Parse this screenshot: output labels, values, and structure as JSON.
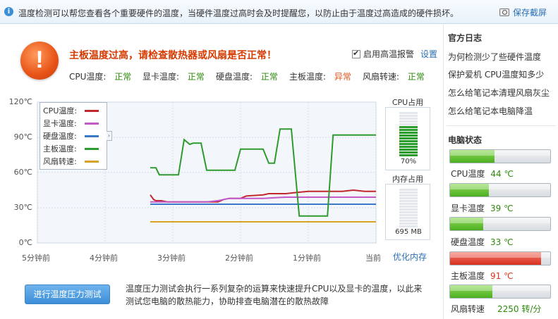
{
  "topbar": {
    "info": "温度检测可以帮您查看各个重要硬件的温度，当硬件温度过高时会及时提醒您，以防止由于温度过高造成的硬件损坏。",
    "save_screenshot": "保存截屏"
  },
  "alert": {
    "title": "主板温度过高，请检查散热器或风扇是否正常！",
    "alarm_label": "启用高温报警",
    "alarm_checked": true,
    "settings": "设置"
  },
  "status": [
    {
      "label": "CPU温度:",
      "value": "正常",
      "ok": true
    },
    {
      "label": "显卡温度:",
      "value": "正常",
      "ok": true
    },
    {
      "label": "硬盘温度:",
      "value": "正常",
      "ok": true
    },
    {
      "label": "主板温度:",
      "value": "异常",
      "ok": false
    },
    {
      "label": "风扇转速:",
      "value": "正常",
      "ok": true
    }
  ],
  "chart_data": {
    "type": "line",
    "ylim": [
      0,
      120
    ],
    "y_ticks": [
      "120℃",
      "90℃",
      "60℃",
      "30℃",
      "0℃"
    ],
    "x_ticks": [
      "5分钟前",
      "4分钟前",
      "3分钟前",
      "2分钟前",
      "1分钟前",
      "当前"
    ],
    "xlim": [
      -300,
      0
    ],
    "grid": true,
    "legend_placement": "top-left",
    "series": [
      {
        "name": "CPU温度:",
        "color": "#c0282e",
        "points": [
          [
            -200,
            41
          ],
          [
            -197,
            37
          ],
          [
            -195,
            36
          ],
          [
            -190,
            36
          ],
          [
            -185,
            35
          ],
          [
            -150,
            35
          ],
          [
            -140,
            35
          ],
          [
            -135,
            37
          ],
          [
            -130,
            38
          ],
          [
            -120,
            38
          ],
          [
            -115,
            40
          ],
          [
            -100,
            41
          ],
          [
            -95,
            42
          ],
          [
            -80,
            42
          ],
          [
            -70,
            43
          ],
          [
            -60,
            44
          ],
          [
            -50,
            44
          ],
          [
            -40,
            44
          ],
          [
            -30,
            44
          ],
          [
            -20,
            45
          ],
          [
            -10,
            44
          ],
          [
            0,
            44
          ]
        ]
      },
      {
        "name": "显卡温度:",
        "color": "#c25ac9",
        "points": [
          [
            -200,
            35
          ],
          [
            -190,
            35
          ],
          [
            -160,
            35
          ],
          [
            -150,
            35
          ],
          [
            -140,
            36
          ],
          [
            -130,
            38
          ],
          [
            -120,
            38
          ],
          [
            -100,
            38
          ],
          [
            -80,
            39
          ],
          [
            -60,
            39
          ],
          [
            -40,
            39
          ],
          [
            -20,
            39
          ],
          [
            0,
            39
          ]
        ]
      },
      {
        "name": "硬盘温度:",
        "color": "#3a78c8",
        "points": [
          [
            -200,
            33
          ],
          [
            -150,
            33
          ],
          [
            -100,
            33
          ],
          [
            -50,
            33
          ],
          [
            0,
            33
          ]
        ]
      },
      {
        "name": "主板温度:",
        "color": "#2e9b2e",
        "points": [
          [
            -200,
            64
          ],
          [
            -195,
            64
          ],
          [
            -192,
            58
          ],
          [
            -175,
            58
          ],
          [
            -170,
            88
          ],
          [
            -165,
            84
          ],
          [
            -162,
            85
          ],
          [
            -155,
            85
          ],
          [
            -150,
            62
          ],
          [
            -135,
            62
          ],
          [
            -125,
            62
          ],
          [
            -120,
            80
          ],
          [
            -105,
            80
          ],
          [
            -100,
            80
          ],
          [
            -95,
            68
          ],
          [
            -90,
            68
          ],
          [
            -85,
            97
          ],
          [
            -75,
            97
          ],
          [
            -68,
            23
          ],
          [
            -60,
            23
          ],
          [
            -50,
            23
          ],
          [
            -43,
            23
          ],
          [
            -38,
            92
          ],
          [
            -20,
            92
          ],
          [
            0,
            92
          ]
        ]
      },
      {
        "name": "风扇转速:",
        "color": "#d8a12a",
        "points": [
          [
            -200,
            18
          ],
          [
            -100,
            18
          ],
          [
            0,
            18
          ]
        ]
      }
    ]
  },
  "cpu_usage": {
    "title": "CPU占用",
    "value": "70%",
    "fraction": 0.7,
    "color": "#2e9b2e"
  },
  "mem_usage": {
    "title": "内存占用",
    "value": "695 MB",
    "fraction": 0.0,
    "color": "#2e9b2e"
  },
  "optimize_memory": "优化内存",
  "stress": {
    "button": "进行温度压力测试",
    "desc": "温度压力测试会执行一系列复杂的运算来快速提升CPU以及显卡的温度，以此来测试您电脑的散热能力，协助排查电脑潜在的散热故障"
  },
  "sidebar": {
    "log_title": "官方日志",
    "links": [
      "为何检测少了些硬件温度",
      "保护爱机 CPU温度知多少",
      "怎么给笔记本清理风扇灰尘",
      "怎么给笔记本电脑降温"
    ],
    "status_title": "电脑状态",
    "meters": [
      {
        "label": "CPU温度",
        "value": "44 ℃",
        "fraction": 0.44,
        "state": "ok"
      },
      {
        "label": "显卡温度",
        "value": "39 ℃",
        "fraction": 0.39,
        "state": "ok"
      },
      {
        "label": "硬盘温度",
        "value": "33 ℃",
        "fraction": 0.33,
        "state": "ok"
      },
      {
        "label": "主板温度",
        "value": "91 ℃",
        "fraction": 0.91,
        "state": "bad"
      },
      {
        "label": "风扇转速",
        "value": "2250 转/分",
        "fraction": 0.42,
        "state": "ok"
      }
    ]
  }
}
